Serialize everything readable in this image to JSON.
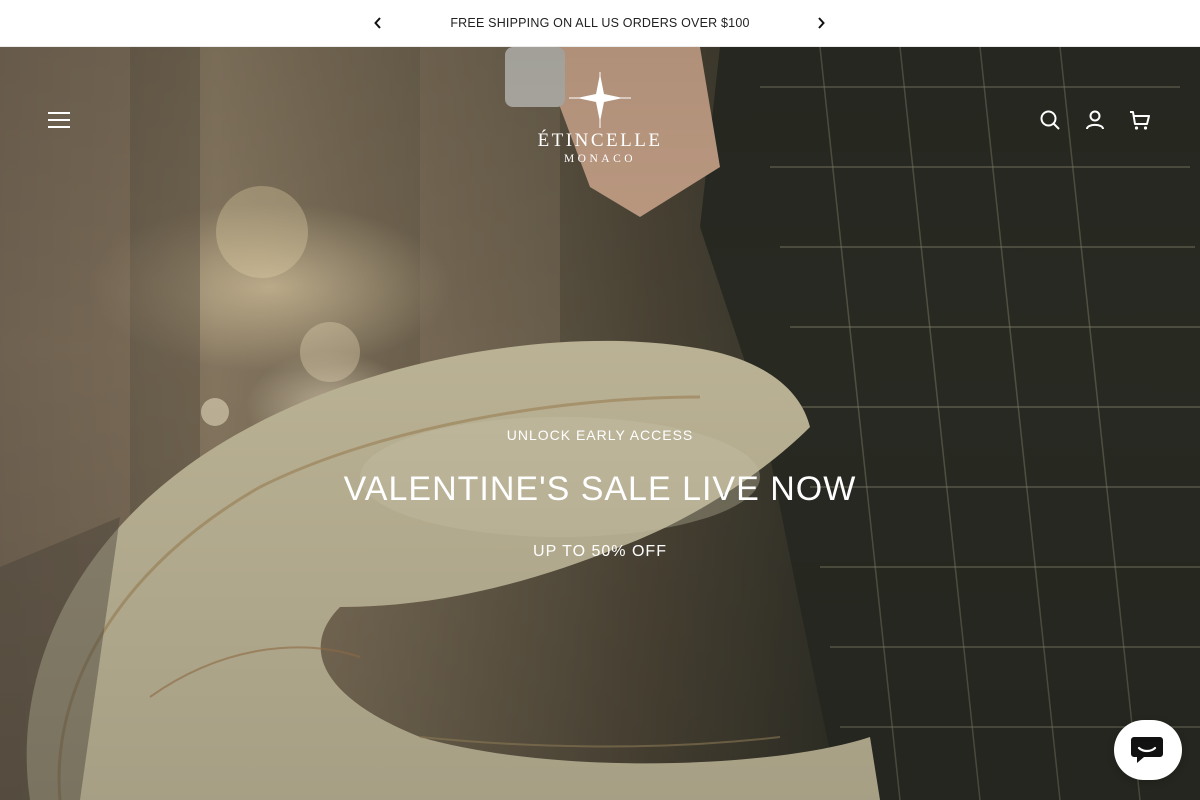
{
  "announcement": {
    "message": "FREE SHIPPING ON ALL US ORDERS OVER $100",
    "prev_icon": "chevron-left-icon",
    "next_icon": "chevron-right-icon"
  },
  "header": {
    "menu_icon": "hamburger-menu-icon",
    "logo": {
      "name": "ÉTINCELLE",
      "sub": "MONACO",
      "emblem": "star-sparkle-icon"
    },
    "icons": [
      "search-icon",
      "account-icon",
      "cart-icon"
    ]
  },
  "hero": {
    "kicker": "UNLOCK EARLY ACCESS",
    "headline": "VALENTINE'S SALE LIVE NOW",
    "offer": "UP TO 50% OFF"
  },
  "chat": {
    "icon": "chat-bubble-icon"
  },
  "colors": {
    "text_dark": "#222222",
    "overlay_text": "#ffffff",
    "announce_bg": "#ffffff"
  }
}
